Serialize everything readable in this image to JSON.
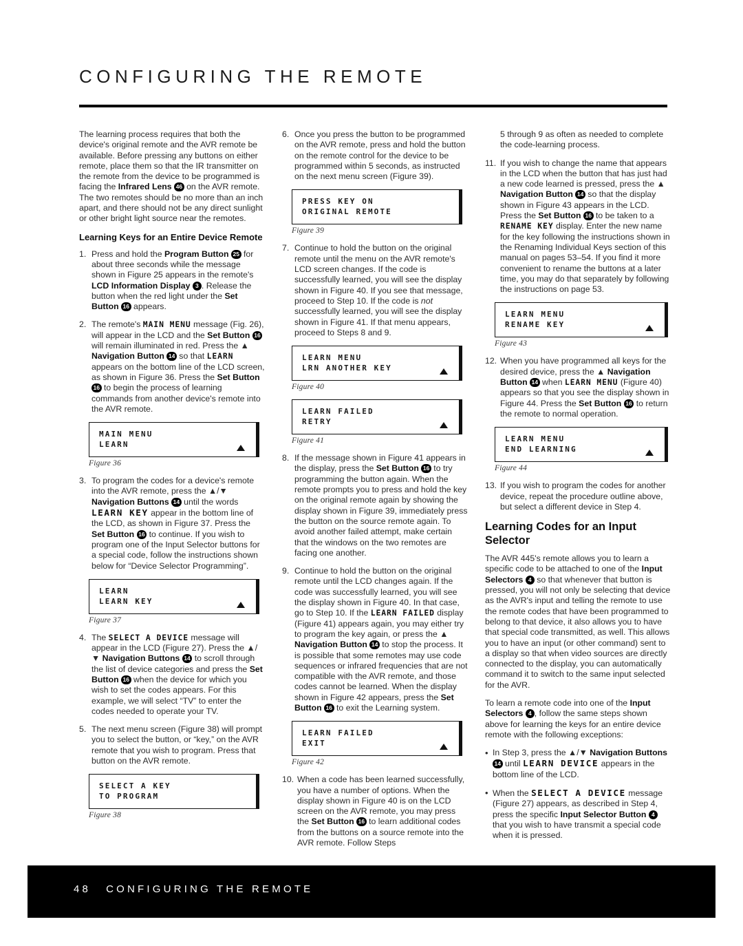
{
  "header": {
    "title": "CONFIGURING THE REMOTE"
  },
  "footer": {
    "page_number": "48",
    "title": "CONFIGURING THE REMOTE"
  },
  "column1": {
    "intro": "The learning process requires that both the device's original remote and the AVR remote be available. Before pressing any buttons on either remote, place them so that the IR transmitter on the remote from the device to be programmed is facing the",
    "intro_bold": "Infrared Lens",
    "intro_badge": "46",
    "intro_rest": "on the AVR remote. The two remotes should be no more than an inch apart, and there should not be any direct sunlight or other bright light source near the remotes.",
    "subhead": "Learning Keys for an Entire Device Remote",
    "steps": [
      {
        "marker": "1.",
        "p1": "Press and hold the",
        "b1": "Program Button",
        "badge1": "25",
        "p2": "for about three seconds while the message shown in Figure 25 appears in the remote's",
        "b2": "LCD Information Display",
        "badge2": "3",
        "p3": ". Release the button when the red light under the",
        "b3": "Set Button",
        "badge3": "16",
        "p4": "appears."
      },
      {
        "marker": "2.",
        "p1": "The remote's",
        "lcd1": "MAIN MENU",
        "p2": "message (Fig. 26), will appear in the LCD and the",
        "b1": "Set Button",
        "badge1": "16",
        "p3": "will remain illuminated in red. Press the ▲",
        "b2": "Navigation Button",
        "badge2": "14",
        "p4": "so that",
        "lcd2": "LEARN",
        "p5": "appears on the bottom line of the LCD screen, as shown in Figure 36. Press the",
        "b3": "Set Button",
        "badge3": "16",
        "p6": "to begin the process of learning commands from another device's remote into the AVR remote."
      },
      {
        "marker": "3.",
        "p1": "To program the codes for a device's remote into the AVR remote, press the ▲/▼",
        "b1": "Navigation Buttons",
        "badge1": "14",
        "p2": "until the words",
        "lcd1": "LEARN KEY",
        "p3": "appear in the bottom line of the LCD, as shown in Figure 37. Press the",
        "b2": "Set Button",
        "badge2": "16",
        "p4": "to continue. If you wish to program one of the Input Selector buttons for a special code, follow the instructions shown below for “Device Selector Programming”."
      },
      {
        "marker": "4.",
        "p1": "The",
        "lcd1": "SELECT A DEVICE",
        "p2": "message will appear in the LCD (Figure 27). Press the ▲/▼",
        "b1": "Navigation Buttons",
        "badge1": "14",
        "p3": "to scroll through the list of device categories and press the",
        "b2": "Set Button",
        "badge2": "16",
        "p4": "when the device for which you wish to set the codes appears. For this example, we will select “TV” to enter the codes needed to operate your TV."
      },
      {
        "marker": "5.",
        "p1": "The next menu screen (Figure 38) will prompt you to select the button, or “key,” on the AVR remote that you wish to program. Press that button on the AVR remote."
      }
    ],
    "figures": [
      {
        "id": "fig36",
        "line1": "MAIN MENU",
        "line2": "LEARN",
        "triangle": true,
        "caption": "Figure 36"
      },
      {
        "id": "fig37",
        "line1": "LEARN",
        "line2": "LEARN KEY",
        "triangle": true,
        "caption": "Figure 37"
      },
      {
        "id": "fig38",
        "line1": "SELECT A KEY",
        "line2": "TO PROGRAM",
        "triangle": false,
        "caption": "Figure 38"
      }
    ]
  },
  "column2": {
    "steps": [
      {
        "marker": "6.",
        "p1": "Once you press the button to be programmed on the AVR remote, press and hold the button on the remote control for the device to be programmed within 5 seconds, as instructed on the next menu screen (Figure 39)."
      },
      {
        "marker": "7.",
        "p1": "Continue to hold the button on the original remote until the menu on the AVR remote's LCD screen changes. If the code is successfully learned, you will see the display shown in Figure 40. If you see that message, proceed to Step 10. If the code is",
        "i1": "not",
        "p2": "successfully learned, you will see the display shown in Figure 41. If that menu appears, proceed to Steps 8 and 9."
      },
      {
        "marker": "8.",
        "p1": "If the message shown in Figure 41 appears in the display, press the",
        "b1": "Set Button",
        "badge1": "16",
        "p2": "to try programming the button again. When the remote prompts you to press and hold the key on the original remote again by showing the display shown in Figure 39, immediately press the button on the source remote again. To avoid another failed attempt, make certain that the windows on the two remotes are facing one another."
      },
      {
        "marker": "9.",
        "p1": "Continue to hold the button on the original remote until the LCD changes again. If the code was successfully learned, you will see the display shown in Figure 40. In that case, go to Step 10. If the",
        "lcd1": "LEARN FAILED",
        "p2": "display (Figure 41) appears again, you may either try to program the key again, or press the ▲",
        "b1": "Navigation Button",
        "badge1": "14",
        "p3": "to stop the process. It is possible that some remotes may use code sequences or infrared frequencies that are not compatible with the AVR remote, and those codes cannot be learned. When the display shown in Figure 42 appears, press the",
        "b2": "Set Button",
        "badge2": "16",
        "p4": "to exit the Learning system."
      },
      {
        "marker": "10.",
        "p1": "When a code has been learned successfully, you have a number of options. When the display shown in Figure 40 is on the LCD screen on the AVR remote, you may press the",
        "b1": "Set Button",
        "badge1": "16",
        "p2": "to learn additional codes from the buttons on a source remote into the AVR remote. Follow Steps"
      }
    ],
    "figures": [
      {
        "id": "fig39",
        "line1": "PRESS KEY ON",
        "line2": "ORIGINAL REMOTE",
        "triangle": false,
        "caption": "Figure 39"
      },
      {
        "id": "fig40",
        "line1": "LEARN MENU",
        "line2": "LRN ANOTHER KEY",
        "triangle": true,
        "caption": "Figure 40"
      },
      {
        "id": "fig41",
        "line1": "LEARN FAILED",
        "line2": "RETRY",
        "triangle": true,
        "caption": "Figure 41"
      },
      {
        "id": "fig42",
        "line1": "LEARN FAILED",
        "line2": "EXIT",
        "triangle": true,
        "caption": "Figure 42"
      }
    ]
  },
  "column3": {
    "continuation": "5 through 9 as often as needed to complete the code-learning process.",
    "steps": [
      {
        "marker": "11.",
        "p1": "If you wish to change the name that appears in the LCD when the button that has just had a new code learned is pressed, press the ▲",
        "b1": "Navigation Button",
        "badge1": "14",
        "p2": "so that the display shown in Figure 43 appears in the LCD. Press the",
        "b2": "Set Button",
        "badge2": "16",
        "p3": "to be taken to a",
        "lcd1": "RENAME KEY",
        "p4": "display. Enter the new name for the key following the instructions shown in the Renaming Individual Keys section of this manual on pages 53–54. If you find it more convenient to rename the buttons at a later time, you may do that separately by following the instructions on page 53."
      },
      {
        "marker": "12.",
        "p1": "When you have programmed all keys for the desired device, press the ▲",
        "b1": "Navigation Button",
        "badge1": "14",
        "p2": "when",
        "lcd1": "LEARN MENU",
        "p3": "(Figure 40) appears so that you see the display shown in Figure 44. Press the",
        "b2": "Set Button",
        "badge2": "16",
        "p4": "to return the remote to normal operation."
      },
      {
        "marker": "13.",
        "p1": "If you wish to program the codes for another device, repeat the procedure outline above, but select a different device in Step 4."
      }
    ],
    "figures": [
      {
        "id": "fig43",
        "line1": "LEARN MENU",
        "line2": "RENAME KEY",
        "triangle": true,
        "caption": "Figure 43"
      },
      {
        "id": "fig44",
        "line1": "LEARN MENU",
        "line2": "END LEARNING",
        "triangle": true,
        "caption": "Figure 44"
      }
    ],
    "section_heading": "Learning Codes for an Input Selector",
    "para1_a": "The AVR 445's remote allows you to learn a specific code to be attached to one of the",
    "para1_b": "Input Selectors",
    "para1_badge": "4",
    "para1_c": "so that whenever that button is pressed, you will not only be selecting that device as the AVR's input and telling the remote to use the remote codes that have been programmed to belong to that device, it also allows you to have that special code transmitted, as well. This allows you to have an input (or other command) sent to a display so that when video sources are directly connected to the display, you can automatically command it to switch to the same input selected for the AVR.",
    "para2_a": "To learn a remote code into one of the",
    "para2_b": "Input Selectors",
    "para2_badge": "4",
    "para2_c": ", follow the same steps shown above for learning the keys for an entire device remote with the following exceptions:",
    "bullets": [
      {
        "marker": "•",
        "p1": "In Step 3, press the ▲/▼",
        "b1": "Navigation Buttons",
        "badge1": "14",
        "p2": "until",
        "lcd1": "LEARN DEVICE",
        "p3": "appears in the bottom line of the LCD."
      },
      {
        "marker": "•",
        "p1": "When the",
        "lcd1": "SELECT A DEVICE",
        "p2": "message (Figure 27) appears, as described in Step 4, press the specific",
        "b1": "Input Selector Button",
        "badge1": "4",
        "p3": "that you wish to have transmit a special code when it is pressed."
      }
    ]
  }
}
